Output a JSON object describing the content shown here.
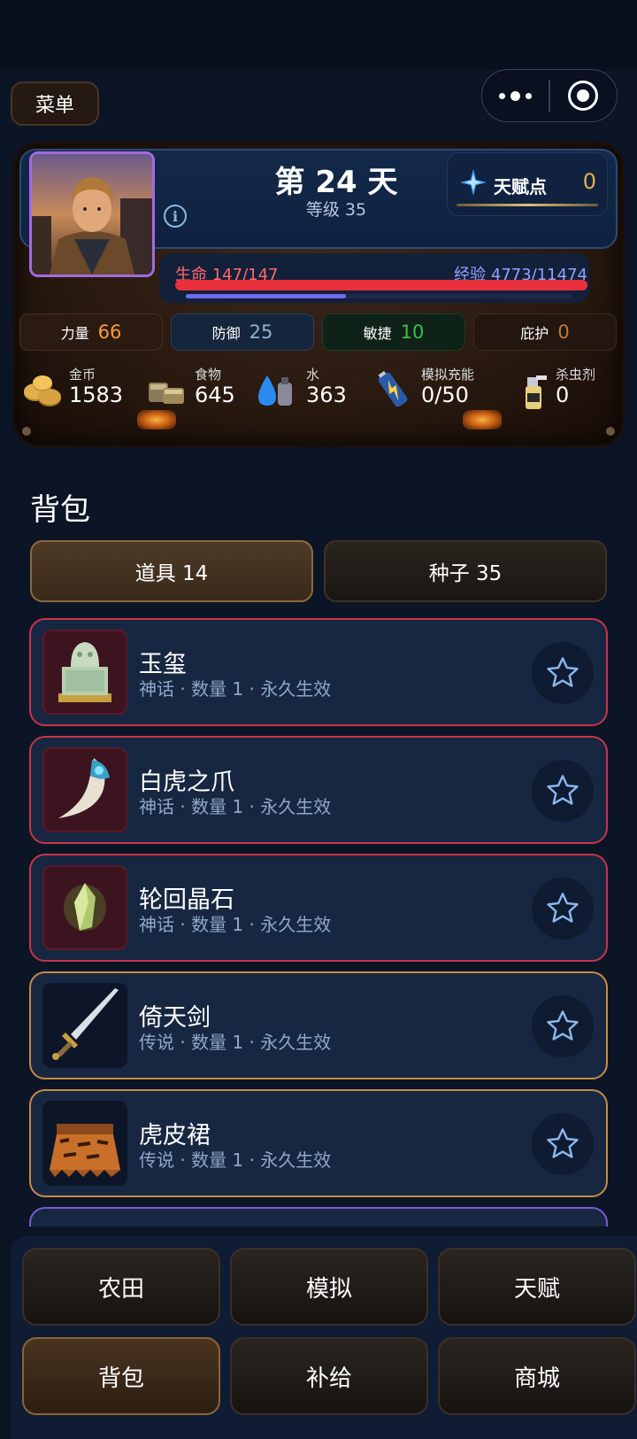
{
  "top": {
    "menu_label": "菜单",
    "capsule": {
      "more_icon": "dots-icon",
      "close_icon": "target-icon"
    }
  },
  "status": {
    "day": "第 24 天",
    "level": "等级 35",
    "talent": {
      "label": "天赋点",
      "value": "0",
      "icon": "gem-icon"
    },
    "hp": {
      "label": "生命 147/147",
      "fraction": 1.0
    },
    "xp": {
      "label": "经验 4773/11474",
      "fraction": 0.416
    },
    "stats": [
      {
        "label": "力量",
        "value": "66",
        "color": "#ff9a3a"
      },
      {
        "label": "防御",
        "value": "25",
        "color": "#8fb0d0"
      },
      {
        "label": "敏捷",
        "value": "10",
        "color": "#3abf4a"
      },
      {
        "label": "庇护",
        "value": "0",
        "color": "#c07a3a"
      }
    ],
    "resources": [
      {
        "label": "金币",
        "value": "1583",
        "icon": "coins-icon"
      },
      {
        "label": "食物",
        "value": "645",
        "icon": "food-icon"
      },
      {
        "label": "水",
        "value": "363",
        "icon": "water-icon"
      },
      {
        "label": "模拟充能",
        "value": "0/50",
        "icon": "battery-icon"
      },
      {
        "label": "杀虫剂",
        "value": "0",
        "icon": "spray-icon"
      }
    ]
  },
  "bag": {
    "title": "背包",
    "tabs": [
      {
        "label": "道具 14"
      },
      {
        "label": "种子 35"
      }
    ],
    "items": [
      {
        "name": "玉玺",
        "meta": "神话 · 数量 1 · 永久生效",
        "icon": "jade-seal-icon"
      },
      {
        "name": "白虎之爪",
        "meta": "神话 · 数量 1 · 永久生效",
        "icon": "tiger-claw-icon"
      },
      {
        "name": "轮回晶石",
        "meta": "神话 · 数量 1 · 永久生效",
        "icon": "crystal-icon"
      },
      {
        "name": "倚天剑",
        "meta": "传说 · 数量 1 · 永久生效",
        "icon": "sword-icon"
      },
      {
        "name": "虎皮裙",
        "meta": "传说 · 数量 1 · 永久生效",
        "icon": "tiger-skirt-icon"
      }
    ]
  },
  "nav": [
    {
      "label": "农田"
    },
    {
      "label": "模拟"
    },
    {
      "label": "天赋"
    },
    {
      "label": "背包"
    },
    {
      "label": "补给"
    },
    {
      "label": "商城"
    }
  ]
}
